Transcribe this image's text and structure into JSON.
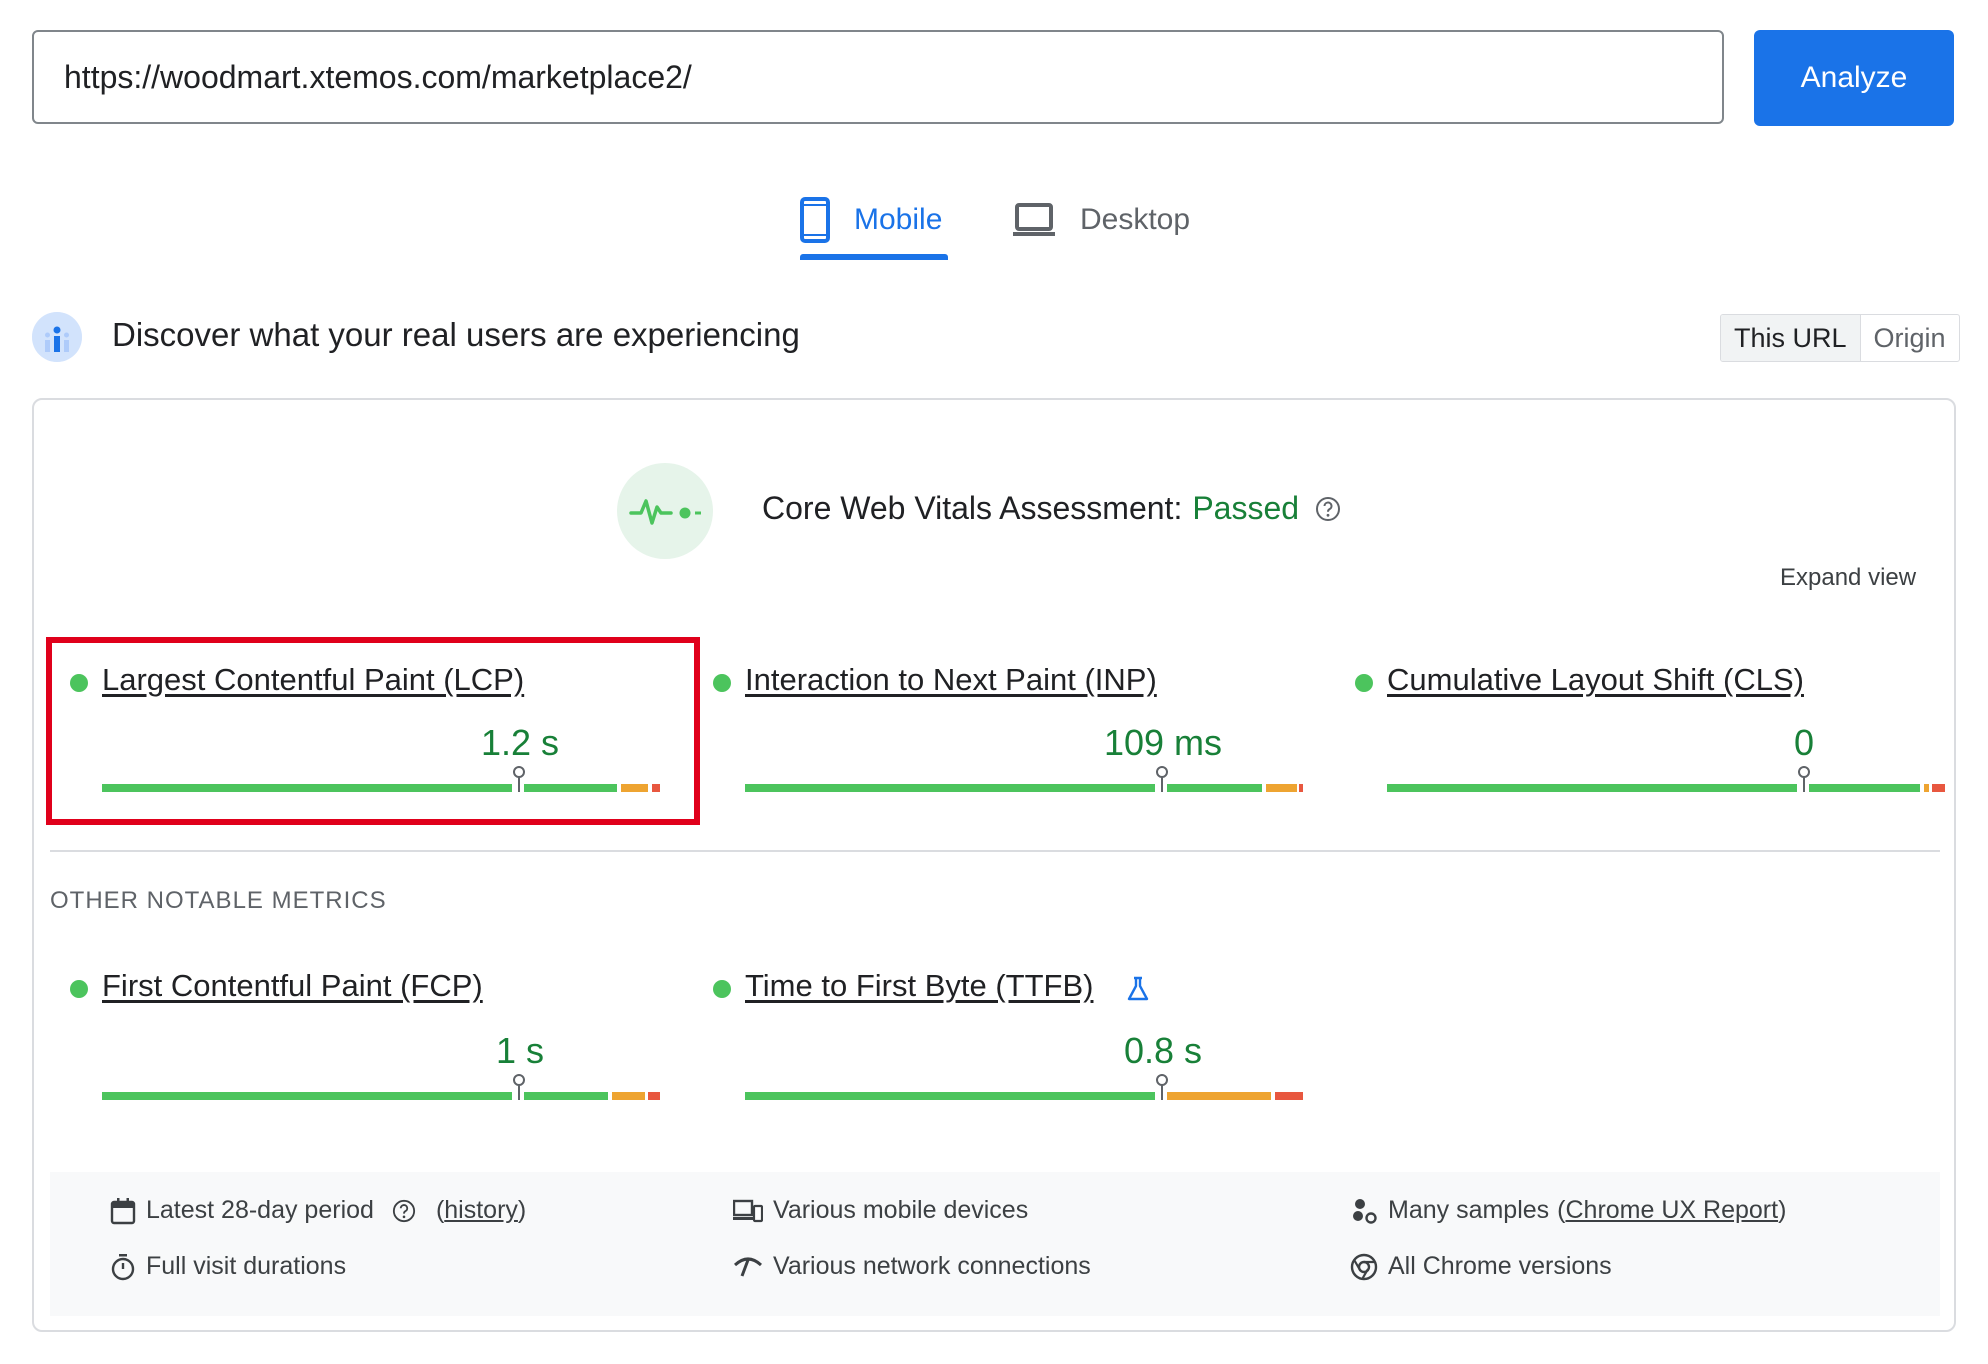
{
  "url_bar": {
    "value": "https://woodmart.xtemos.com/marketplace2/",
    "analyze_label": "Analyze"
  },
  "tabs": [
    {
      "label": "Mobile",
      "active": true
    },
    {
      "label": "Desktop",
      "active": false
    }
  ],
  "field_section": {
    "title": "Discover what your real users are experiencing",
    "toggle": {
      "this_url": "This URL",
      "origin": "Origin",
      "selected": "This URL"
    }
  },
  "assessment": {
    "label": "Core Web Vitals Assessment:",
    "status": "Passed",
    "expand_label": "Expand view"
  },
  "core_metrics": [
    {
      "name": "Largest Contentful Paint (LCP)",
      "value": "1.2 s",
      "status": "good",
      "distribution": [
        0.91,
        0.06,
        0.03
      ]
    },
    {
      "name": "Interaction to Next Paint (INP)",
      "value": "109 ms",
      "status": "good",
      "distribution": [
        0.92,
        0.06,
        0.02
      ]
    },
    {
      "name": "Cumulative Layout Shift (CLS)",
      "value": "0",
      "status": "good",
      "distribution": [
        0.97,
        0.01,
        0.02
      ]
    }
  ],
  "other_section_title": "OTHER NOTABLE METRICS",
  "other_metrics": [
    {
      "name": "First Contentful Paint (FCP)",
      "value": "1 s",
      "status": "good",
      "experimental": false,
      "distribution": [
        0.9,
        0.07,
        0.03
      ]
    },
    {
      "name": "Time to First Byte (TTFB)",
      "value": "0.8 s",
      "status": "good",
      "experimental": true,
      "distribution": [
        0.75,
        0.2,
        0.05
      ]
    }
  ],
  "footer": {
    "period": "Latest 28-day period",
    "history": "history",
    "durations": "Full visit durations",
    "devices": "Various mobile devices",
    "network": "Various network connections",
    "samples": "Many samples",
    "crux_link": "Chrome UX Report",
    "chrome": "All Chrome versions"
  },
  "colors": {
    "accent": "#1a73e8",
    "good": "#4cc45d",
    "needs_improvement": "#eea431",
    "poor": "#e8573f",
    "pass_text": "#188038",
    "highlight": "#e0001b"
  }
}
